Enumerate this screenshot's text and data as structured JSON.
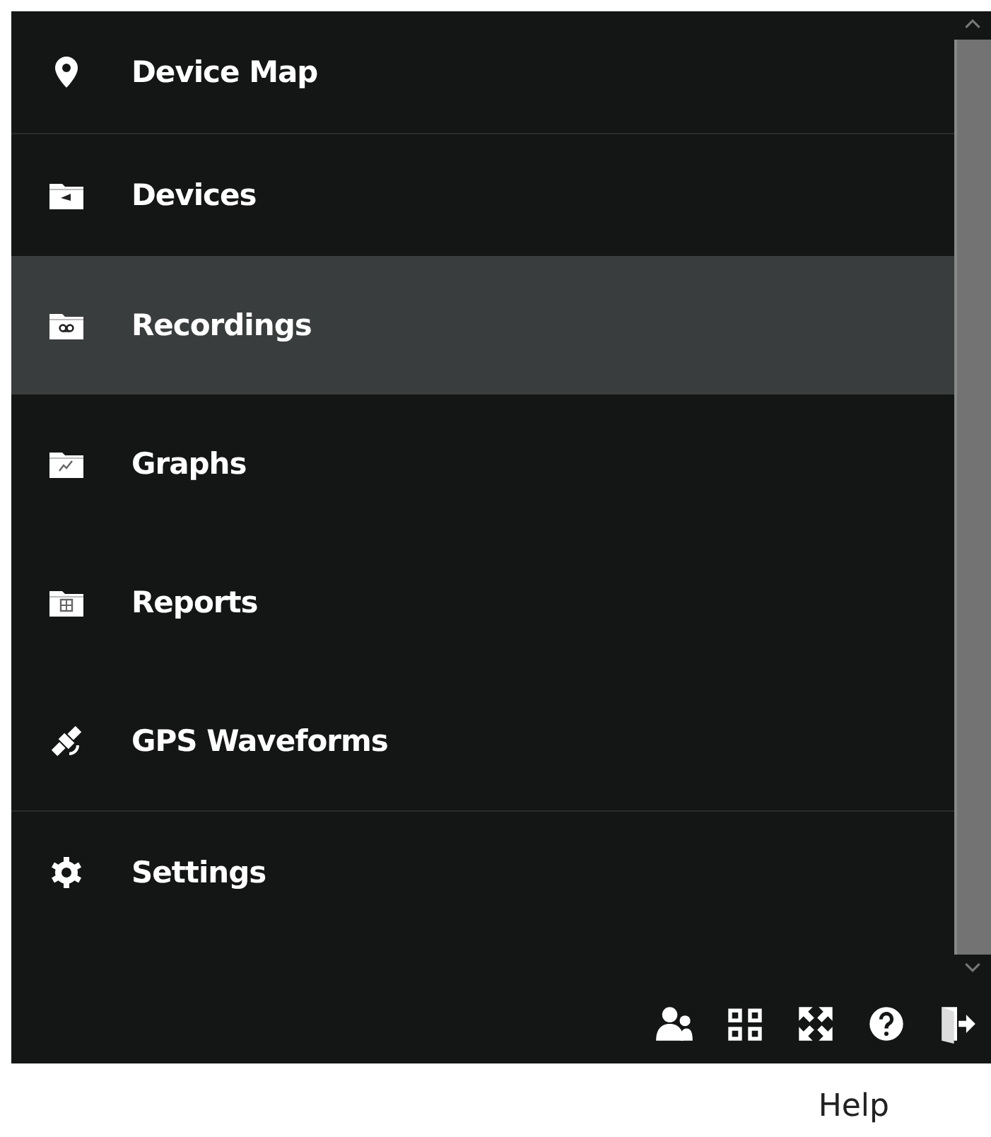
{
  "sidebar": {
    "sections": [
      {
        "items": [
          {
            "label": "Device Map",
            "kind": "pin",
            "selected": false
          }
        ]
      },
      {
        "items": [
          {
            "label": "Devices",
            "kind": "folder-device",
            "selected": false
          },
          {
            "label": "Recordings",
            "kind": "folder-recording",
            "selected": true
          },
          {
            "label": "Graphs",
            "kind": "folder-graph",
            "selected": false
          },
          {
            "label": "Reports",
            "kind": "folder-report",
            "selected": false
          },
          {
            "label": "GPS Waveforms",
            "kind": "satellite",
            "selected": false
          }
        ]
      },
      {
        "items": [
          {
            "label": "Settings",
            "kind": "gear",
            "selected": false
          }
        ]
      }
    ]
  },
  "toolbar": {
    "buttons": [
      {
        "kind": "users"
      },
      {
        "kind": "grid"
      },
      {
        "kind": "fullscreen"
      },
      {
        "kind": "help"
      },
      {
        "kind": "logout"
      }
    ],
    "tooltip": "Help"
  }
}
